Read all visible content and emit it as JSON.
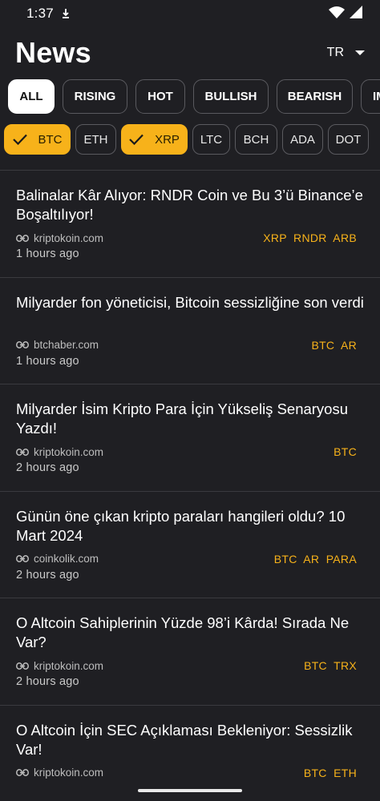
{
  "status_bar": {
    "time": "1:37",
    "icons": [
      "data-saver-icon",
      "wifi-icon",
      "signal-icon"
    ]
  },
  "header": {
    "title": "News",
    "language": "TR"
  },
  "filters": [
    {
      "label": "ALL",
      "active": true
    },
    {
      "label": "RISING",
      "active": false
    },
    {
      "label": "HOT",
      "active": false
    },
    {
      "label": "BULLISH",
      "active": false
    },
    {
      "label": "BEARISH",
      "active": false
    },
    {
      "label": "IM",
      "active": false
    }
  ],
  "coins": [
    {
      "label": "BTC",
      "selected": true
    },
    {
      "label": "ETH",
      "selected": false
    },
    {
      "label": "XRP",
      "selected": true
    },
    {
      "label": "LTC",
      "selected": false
    },
    {
      "label": "BCH",
      "selected": false
    },
    {
      "label": "ADA",
      "selected": false
    },
    {
      "label": "DOT",
      "selected": false
    }
  ],
  "news": [
    {
      "title": "Balinalar Kâr Alıyor: RNDR Coin ve Bu 3’ü Binance’e Boşaltılıyor!",
      "source": "kriptokoin.com",
      "tags": "XRP  RNDR  ARB",
      "time": "1 hours ago"
    },
    {
      "title": "Milyarder fon yöneticisi, Bitcoin sessizliğine son verdi",
      "source": "btchaber.com",
      "tags": "BTC  AR",
      "time": "1 hours ago"
    },
    {
      "title": "Milyarder İsim Kripto Para İçin Yükseliş Senaryosu Yazdı!",
      "source": "kriptokoin.com",
      "tags": "BTC",
      "time": "2 hours ago"
    },
    {
      "title": "Günün öne çıkan kripto paraları hangileri oldu? 10 Mart 2024",
      "source": "coinkolik.com",
      "tags": "BTC  AR  PARA",
      "time": "2 hours ago"
    },
    {
      "title": "O Altcoin Sahiplerinin Yüzde 98’i Kârda! Sırada Ne Var?",
      "source": "kriptokoin.com",
      "tags": "BTC  TRX",
      "time": "2 hours ago"
    },
    {
      "title": "O Altcoin İçin SEC Açıklaması Bekleniyor: Sessizlik Var!",
      "source": "kriptokoin.com",
      "tags": "BTC  ETH",
      "time": ""
    }
  ],
  "colors": {
    "background": "#1f1f23",
    "accent": "#f7b21a",
    "chip_border": "#5a5a5f"
  }
}
